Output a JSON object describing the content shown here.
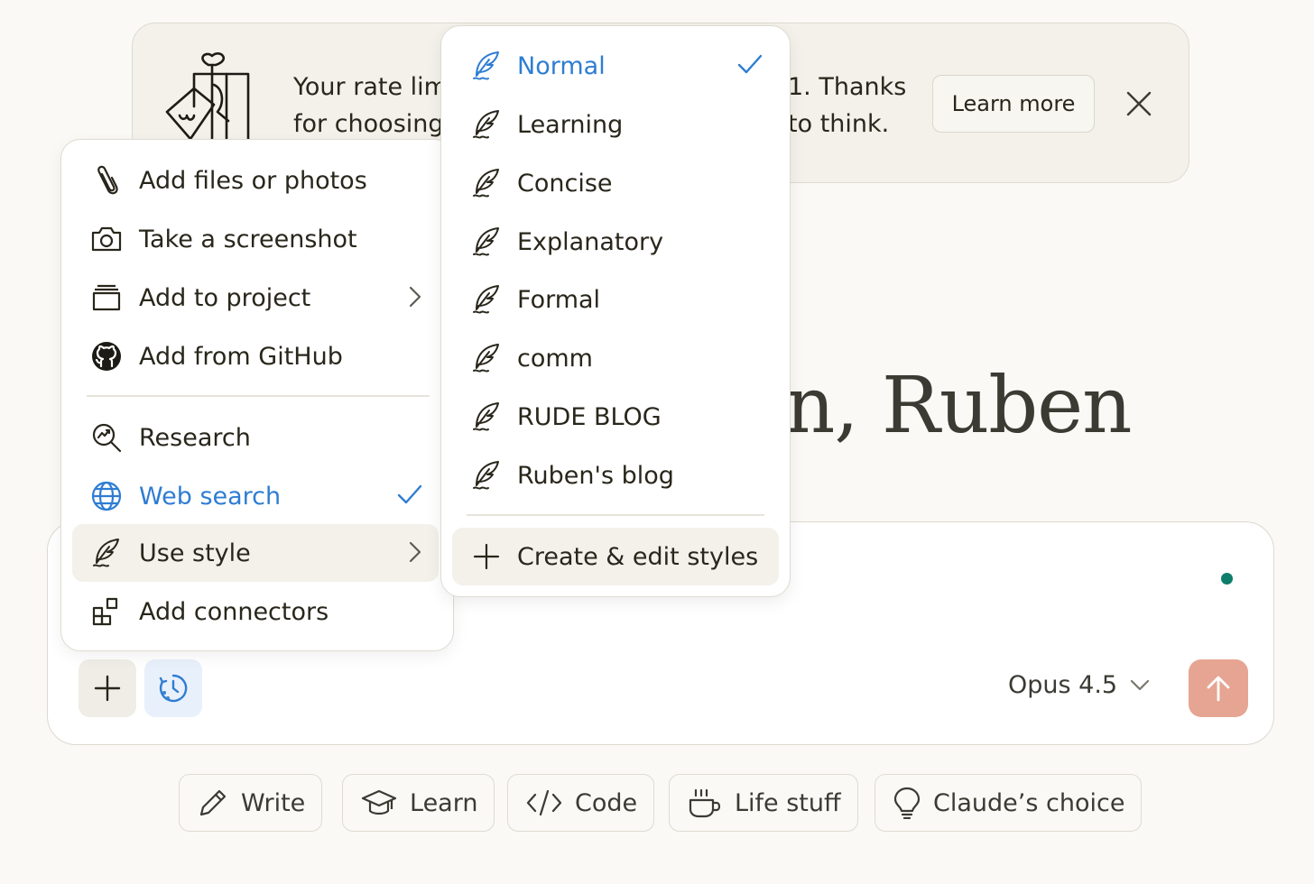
{
  "banner": {
    "text_left_line1": "Your rate lim",
    "text_left_line2": "for choosing",
    "text_right_line1": "1. Thanks",
    "text_right_line2": "to think.",
    "learn_more": "Learn more"
  },
  "greeting": {
    "text": "n, Ruben"
  },
  "attach_menu": {
    "items": [
      {
        "label": "Add files or photos",
        "icon": "paperclip-icon"
      },
      {
        "label": "Take a screenshot",
        "icon": "camera-icon"
      },
      {
        "label": "Add to project",
        "icon": "project-icon",
        "submenu": true
      },
      {
        "label": "Add from GitHub",
        "icon": "github-icon"
      },
      {
        "label": "Research",
        "icon": "research-icon"
      },
      {
        "label": "Web search",
        "icon": "globe-icon",
        "checked": true
      },
      {
        "label": "Use style",
        "icon": "quill-icon",
        "submenu": true
      },
      {
        "label": "Add connectors",
        "icon": "connectors-icon"
      }
    ]
  },
  "style_menu": {
    "items": [
      {
        "label": "Normal",
        "checked": true
      },
      {
        "label": "Learning"
      },
      {
        "label": "Concise"
      },
      {
        "label": "Explanatory"
      },
      {
        "label": "Formal"
      },
      {
        "label": "comm"
      },
      {
        "label": "RUDE BLOG"
      },
      {
        "label": "Ruben's blog"
      }
    ],
    "create": "Create & edit styles"
  },
  "composer": {
    "model": "Opus 4.5"
  },
  "chips": [
    {
      "label": "Write",
      "icon": "pencil-icon"
    },
    {
      "label": "Learn",
      "icon": "graduation-cap-icon"
    },
    {
      "label": "Code",
      "icon": "code-icon"
    },
    {
      "label": "Life stuff",
      "icon": "coffee-cup-icon"
    },
    {
      "label": "Claude’s choice",
      "icon": "lightbulb-icon"
    }
  ],
  "colors": {
    "accent_blue": "#2e7dd2",
    "send_button": "#e6a592",
    "status_dot": "#0f7d6c",
    "background": "#faf9f5"
  }
}
